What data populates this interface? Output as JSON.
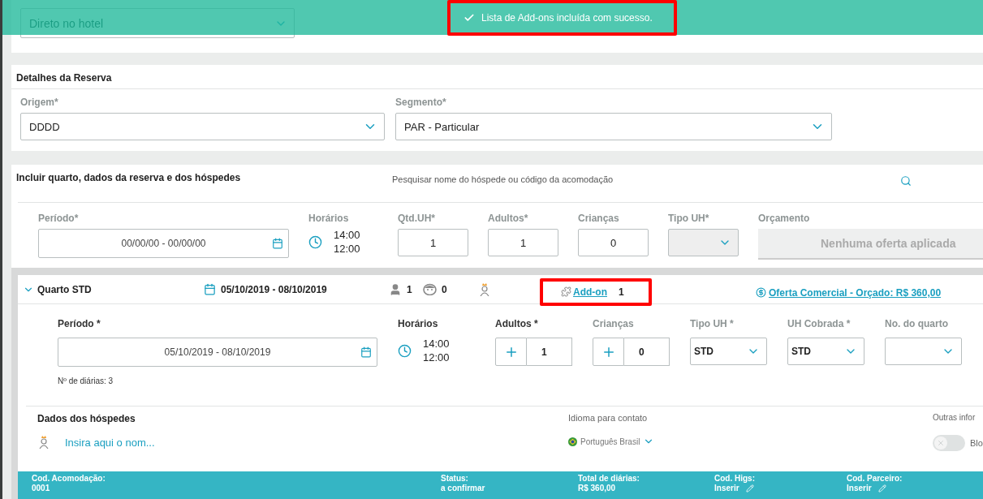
{
  "toast": {
    "message": "Lista de Add-ons incluída com sucesso.",
    "highlighted": true
  },
  "channel_select": {
    "value": "Direto no hotel"
  },
  "reservation_details": {
    "title": "Detalhes da Reserva",
    "fields": [
      {
        "label": "Origem*",
        "value": "DDDD"
      },
      {
        "label": "Segmento*",
        "value": "PAR - Particular"
      }
    ]
  },
  "room_entry": {
    "title": "Incluir quarto, dados da reserva e dos hóspedes",
    "search": {
      "placeholder": "Pesquisar nome do hóspede ou código da acomodação"
    },
    "period": {
      "label": "Período*",
      "value": "00/00/00 - 00/00/00"
    },
    "times": {
      "label": "Horários",
      "checkin": "14:00",
      "checkout": "12:00"
    },
    "counts": [
      {
        "label": "Qtd.UH*",
        "value": "1"
      },
      {
        "label": "Adultos*",
        "value": "1"
      },
      {
        "label": "Crianças",
        "value": "0"
      }
    ],
    "room_type": {
      "label": "Tipo UH*",
      "disabled": true
    },
    "budget": {
      "label": "Orçamento",
      "button": "Nenhuma oferta aplicada"
    }
  },
  "room": {
    "title": "Quarto STD",
    "expanded": true,
    "dates": "05/10/2019 - 08/10/2019",
    "adults": "1",
    "children": "0",
    "addon": {
      "label": "Add-on",
      "count": "1",
      "highlighted": true
    },
    "offer": "Oferta Comercial - Orçado: R$ 360,00",
    "period": {
      "label": "Período *",
      "value": "05/10/2019 - 08/10/2019",
      "nights": "Nº de diárias: 3"
    },
    "times": {
      "label": "Horários",
      "checkin": "14:00",
      "checkout": "12:00"
    },
    "steppers": [
      {
        "label": "Adultos *",
        "value": "1",
        "required": true
      },
      {
        "label": "Crianças",
        "value": "0",
        "required": false
      }
    ],
    "selects": [
      {
        "label": "Tipo UH *",
        "value": "STD"
      },
      {
        "label": "UH Cobrada *",
        "value": "STD"
      },
      {
        "label": "No. do quarto"
      }
    ],
    "guests": {
      "title": "Dados dos hóspedes",
      "name_link": "Insira aqui o nom...",
      "language_label": "Idioma para contato",
      "language": "Português Brasil",
      "other_label": "Outras infor",
      "block_toggle": {
        "label": "Blo",
        "on": false
      }
    }
  },
  "footer": [
    {
      "label": "Cod. Acomodação:",
      "value": "0001",
      "editable": false
    },
    {
      "label": "Status:",
      "value": "a confirmar",
      "editable": false
    },
    {
      "label": "Total de diárias:",
      "value": "R$ 360,00",
      "editable": false
    },
    {
      "label": "Cod. Higs:",
      "value": "Inserir",
      "editable": true
    },
    {
      "label": "Cod. Parceiro:",
      "value": "Inserir",
      "editable": true
    }
  ]
}
